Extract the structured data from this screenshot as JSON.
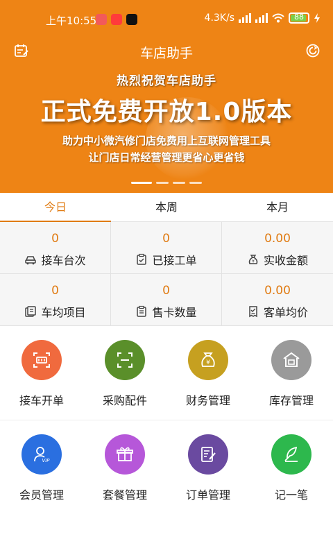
{
  "status": {
    "time": "上午10:55",
    "net_speed": "4.3K/s",
    "battery": "88"
  },
  "header": {
    "title": "车店助手"
  },
  "banner": {
    "small": "热烈祝贺车店助手",
    "big": "正式免费开放1.0版本",
    "line1": "助力中小微汽修门店免费用上互联网管理工具",
    "line2": "让门店日常经营管理更省心更省钱"
  },
  "tabs": [
    {
      "label": "今日"
    },
    {
      "label": "本周"
    },
    {
      "label": "本月"
    }
  ],
  "stats": [
    {
      "value": "0",
      "label": "接车台次",
      "icon": "car-icon"
    },
    {
      "value": "0",
      "label": "已接工单",
      "icon": "clipboard-check-icon"
    },
    {
      "value": "0.00",
      "label": "实收金额",
      "icon": "money-bag-icon"
    },
    {
      "value": "0",
      "label": "车均项目",
      "icon": "list-document-icon"
    },
    {
      "value": "0",
      "label": "售卡数量",
      "icon": "card-clipboard-icon"
    },
    {
      "value": "0.00",
      "label": "客单均价",
      "icon": "receipt-icon"
    }
  ],
  "grid": [
    {
      "label": "接车开单",
      "icon": "scan-card-icon",
      "color": "#f06a3e"
    },
    {
      "label": "采购配件",
      "icon": "scan-frame-icon",
      "color": "#5a8f2a"
    },
    {
      "label": "财务管理",
      "icon": "yen-bag-icon",
      "color": "#c6a020"
    },
    {
      "label": "库存管理",
      "icon": "warehouse-icon",
      "color": "#9a9a9a"
    },
    {
      "label": "会员管理",
      "icon": "vip-user-icon",
      "color": "#2a6fe0"
    },
    {
      "label": "套餐管理",
      "icon": "gift-icon",
      "color": "#b657d9"
    },
    {
      "label": "订单管理",
      "icon": "order-edit-icon",
      "color": "#6a4aa0"
    },
    {
      "label": "记一笔",
      "icon": "feather-note-icon",
      "color": "#2db84d"
    }
  ],
  "colors": {
    "brand": "#ee8415",
    "accent": "#e07b12"
  }
}
